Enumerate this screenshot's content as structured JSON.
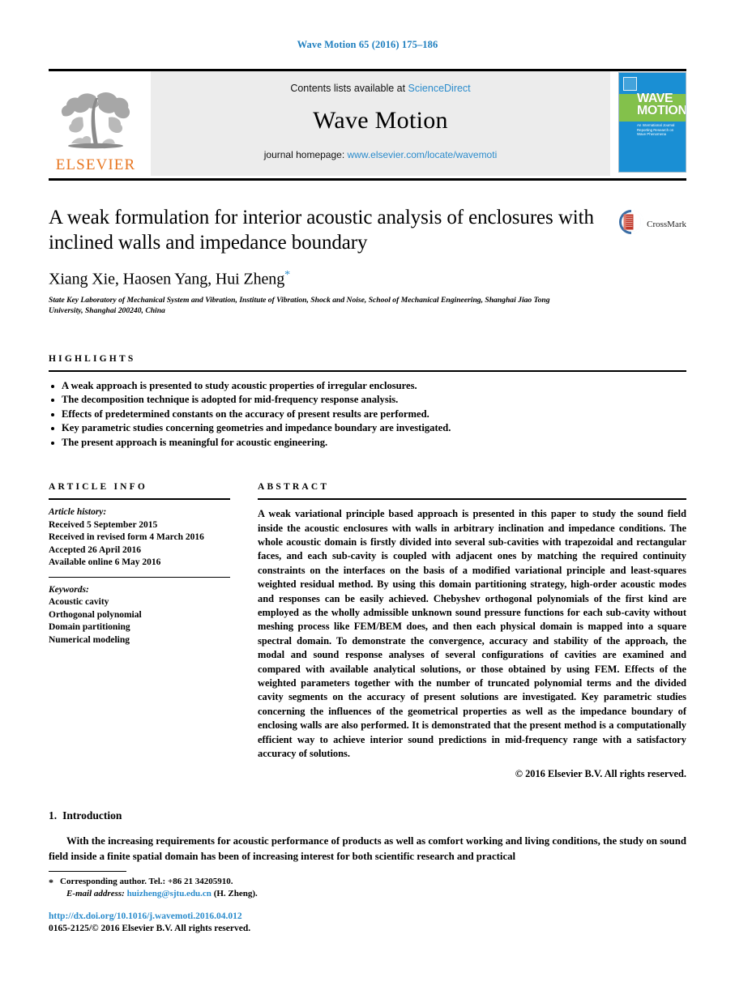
{
  "running_head": "Wave Motion 65 (2016) 175–186",
  "masthead": {
    "elsevier_wordmark": "ELSEVIER",
    "contents_prefix": "Contents lists available at ",
    "contents_link": "ScienceDirect",
    "journal_name": "Wave Motion",
    "homepage_prefix": "journal homepage: ",
    "homepage_link": "www.elsevier.com/locate/wavemoti",
    "cover": {
      "title_line1": "WAVE",
      "title_line2": "MOTION",
      "subtitle": "An International Journal Reporting Research on Wave Phenomena"
    }
  },
  "article": {
    "title": "A weak formulation for interior acoustic analysis of enclosures with inclined walls and impedance boundary",
    "authors": "Xiang Xie, Haosen Yang, Hui Zheng",
    "corresponding_mark": "*",
    "affiliation": "State Key Laboratory of Mechanical System and Vibration, Institute of Vibration, Shock and Noise, School of Mechanical Engineering, Shanghai Jiao Tong University, Shanghai 200240, China",
    "crossmark_label": "CrossMark"
  },
  "highlights": {
    "heading": "Highlights",
    "items": [
      "A weak approach is presented to study acoustic properties of irregular enclosures.",
      "The decomposition technique is adopted for mid-frequency response analysis.",
      "Effects of predetermined constants on the accuracy of present results are performed.",
      "Key parametric studies concerning geometries and impedance boundary are investigated.",
      "The present approach is meaningful for acoustic engineering."
    ]
  },
  "article_info": {
    "heading": "Article info",
    "history_label": "Article history:",
    "history": [
      "Received 5 September 2015",
      "Received in revised form 4 March 2016",
      "Accepted 26 April 2016",
      "Available online 6 May 2016"
    ],
    "keywords_label": "Keywords:",
    "keywords": [
      "Acoustic cavity",
      "Orthogonal polynomial",
      "Domain partitioning",
      "Numerical modeling"
    ]
  },
  "abstract": {
    "heading": "Abstract",
    "body": "A weak variational principle based approach is presented in this paper to study the sound field inside the acoustic enclosures with walls in arbitrary inclination and impedance conditions. The whole acoustic domain is firstly divided into several sub-cavities with trapezoidal and rectangular faces, and each sub-cavity is coupled with adjacent ones by matching the required continuity constraints on the interfaces on the basis of a modified variational principle and least-squares weighted residual method. By using this domain partitioning strategy, high-order acoustic modes and responses can be easily achieved. Chebyshev orthogonal polynomials of the first kind are employed as the wholly admissible unknown sound pressure functions for each sub-cavity without meshing process like FEM/BEM does, and then each physical domain is mapped into a square spectral domain. To demonstrate the convergence, accuracy and stability of the approach, the modal and sound response analyses of several configurations of cavities are examined and compared with available analytical solutions, or those obtained by using FEM. Effects of the weighted parameters together with the number of truncated polynomial terms and the divided cavity segments on the accuracy of present solutions are investigated. Key parametric studies concerning the influences of the geometrical properties as well as the impedance boundary of enclosing walls are also performed. It is demonstrated that the present method is a computationally efficient way to achieve interior sound predictions in mid-frequency range with a satisfactory accuracy of solutions.",
    "copyright": "© 2016 Elsevier B.V. All rights reserved."
  },
  "introduction": {
    "number": "1.",
    "heading": "Introduction",
    "paragraph": "With the increasing requirements for acoustic performance of products as well as comfort working and living conditions, the study on sound field inside a finite spatial domain has been of increasing interest for both scientific research and practical"
  },
  "footer": {
    "corresponding_star": "*",
    "corresponding_text": "Corresponding author. Tel.: +86 21 34205910.",
    "email_label": "E-mail address:",
    "email": "huizheng@sjtu.edu.cn",
    "email_owner": "(H. Zheng).",
    "doi": "http://dx.doi.org/10.1016/j.wavemoti.2016.04.012",
    "issn_line": "0165-2125/© 2016 Elsevier B.V. All rights reserved."
  },
  "colors": {
    "link": "#2b8ccc",
    "running_head": "#1f7fbf",
    "elsevier_orange": "#E87722",
    "cover_blue": "#1a8fd4",
    "cover_green": "#8cc63f",
    "band_gray": "#ececec"
  }
}
